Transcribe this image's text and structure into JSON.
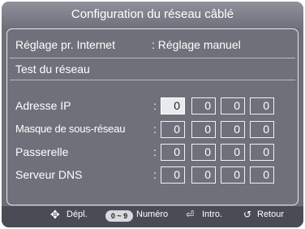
{
  "window": {
    "title": "Configuration du réseau câblé"
  },
  "settings": {
    "internet_label": "Réglage pr. Internet",
    "internet_value": ": Réglage manuel",
    "test_label": "Test du réseau"
  },
  "fields": [
    {
      "label": "Adresse IP",
      "values": [
        "0",
        "0",
        "0",
        "0"
      ]
    },
    {
      "label": "Masque de sous-réseau",
      "values": [
        "0",
        "0",
        "0",
        "0"
      ]
    },
    {
      "label": "Passerelle",
      "values": [
        "0",
        "0",
        "0",
        "0"
      ]
    },
    {
      "label": "Serveur DNS",
      "values": [
        "0",
        "0",
        "0",
        "0"
      ]
    }
  ],
  "footer": {
    "move_label": "Dépl.",
    "number_badge": "0 ~ 9",
    "number_label": "Numéro",
    "enter_label": "Intro.",
    "return_label": "Retour"
  },
  "colors": {
    "panel_bg": "#6f717a",
    "selected_box": "#e9eaee",
    "footer_bg": "#4a4c55"
  }
}
